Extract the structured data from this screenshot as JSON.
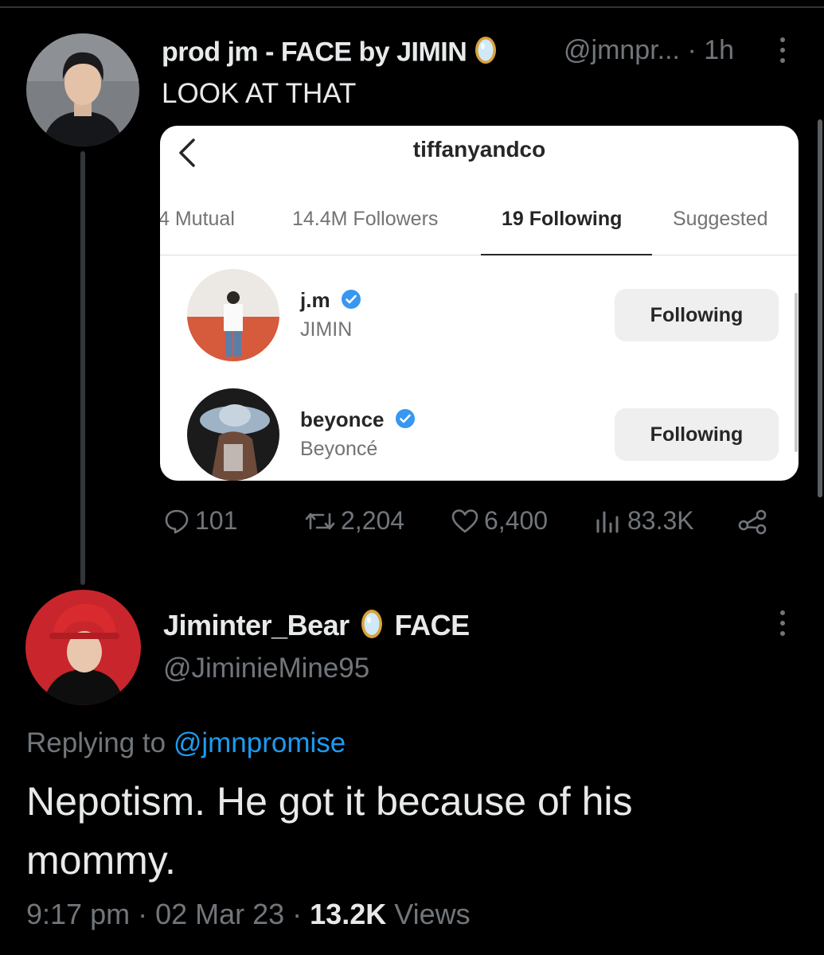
{
  "tweet": {
    "display_name": "prod jm - FACE by JIMIN",
    "handle": "@jmnpr...",
    "time": "· 1h",
    "text": "LOOK AT THAT",
    "badge_icon": "mirror-emoji-icon",
    "embedded_card": {
      "title": "tiffanyandco",
      "tabs": [
        "4 Mutual",
        "14.4M Followers",
        "19 Following",
        "Suggested"
      ],
      "active_tab": "19 Following",
      "rows": [
        {
          "username": "j.m",
          "full_name": "JIMIN",
          "button": "Following",
          "verified": true
        },
        {
          "username": "beyonce",
          "full_name": "Beyoncé",
          "button": "Following",
          "verified": true
        }
      ]
    },
    "stats": {
      "replies": "101",
      "retweets": "2,204",
      "likes": "6,400",
      "views": "83.3K"
    }
  },
  "reply": {
    "display_name": "Jiminter_Bear",
    "name_suffix": "FACE",
    "handle": "@JiminieMine95",
    "replying_prefix": "Replying to",
    "replying_to": "@jmnpromise",
    "text": "Nepotism. He got it because of his mommy.",
    "timestamp": "9:17 pm · 02 Mar 23 · ",
    "views_count": "13.2K",
    "views_label": "Views"
  },
  "colors": {
    "background": "#000000",
    "text": "#e7e9ea",
    "muted": "#71767b",
    "link": "#1d9bf0",
    "verified": "#3897f0"
  }
}
